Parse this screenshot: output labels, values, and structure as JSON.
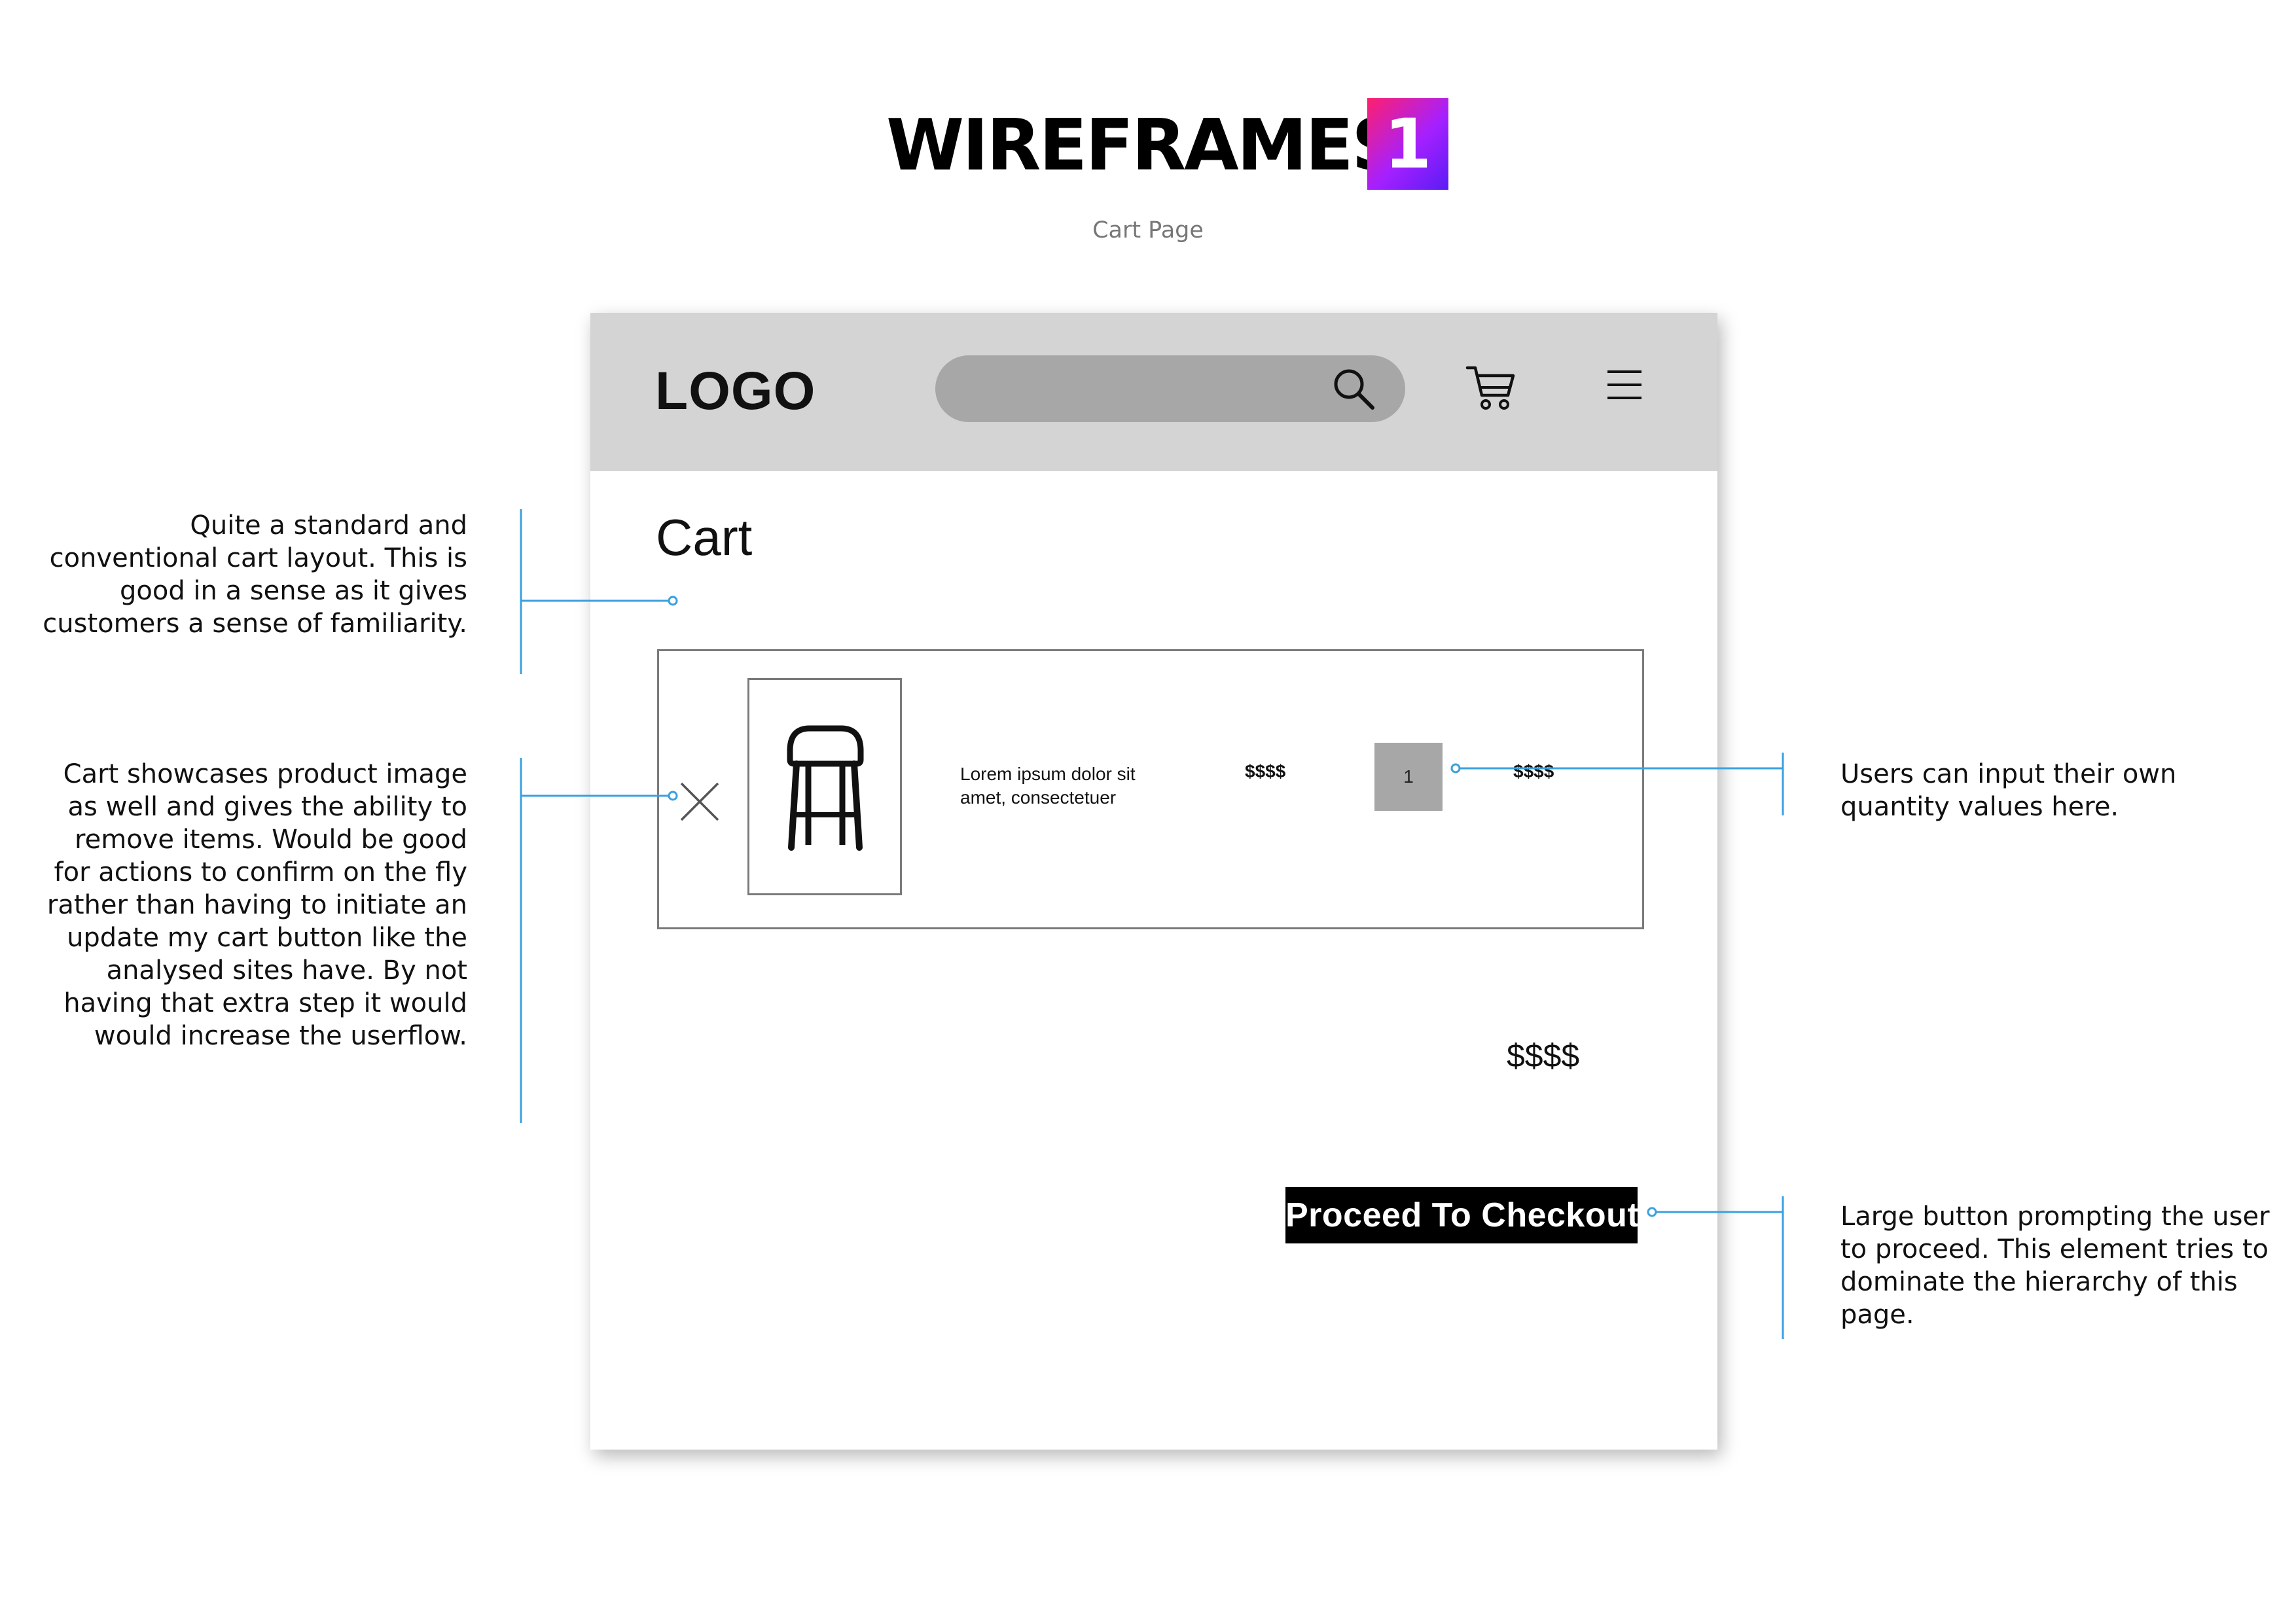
{
  "header": {
    "title": "WIREFRAMES",
    "badge": "1",
    "subtitle": "Cart Page"
  },
  "wireframe": {
    "logo": "LOGO",
    "page_title": "Cart",
    "item": {
      "name": "Lorem ipsum dolor sit amet, consectetuer",
      "price": "$$$$",
      "quantity": "1",
      "line_total": "$$$$"
    },
    "total": "$$$$",
    "checkout_label": "Proceed To Checkout",
    "icons": [
      "search-icon",
      "cart-icon",
      "menu-icon",
      "close-icon",
      "stool-icon"
    ]
  },
  "annotations": {
    "layout": "Quite a standard and conventional cart layout. This is good in a sense as it gives customers a sense of familiarity.",
    "product": "Cart showcases product image as well and gives the ability to remove items. Would be good for actions to confirm on the fly rather than having to initiate an update my cart button like the analysed sites have. By not having that extra step it would would increase the userflow.",
    "quantity": "Users can input their own quantity values here.",
    "checkout": "Large button prompting the user to proceed. This element tries to dominate the hierarchy of this page."
  },
  "colors": {
    "accent_line": "#3aa0e0",
    "badge_gradient_start": "#ff1f6d",
    "badge_gradient_end": "#5a1cf5",
    "nav_background": "#d4d4d4",
    "placeholder_gray": "#a7a7a7"
  }
}
